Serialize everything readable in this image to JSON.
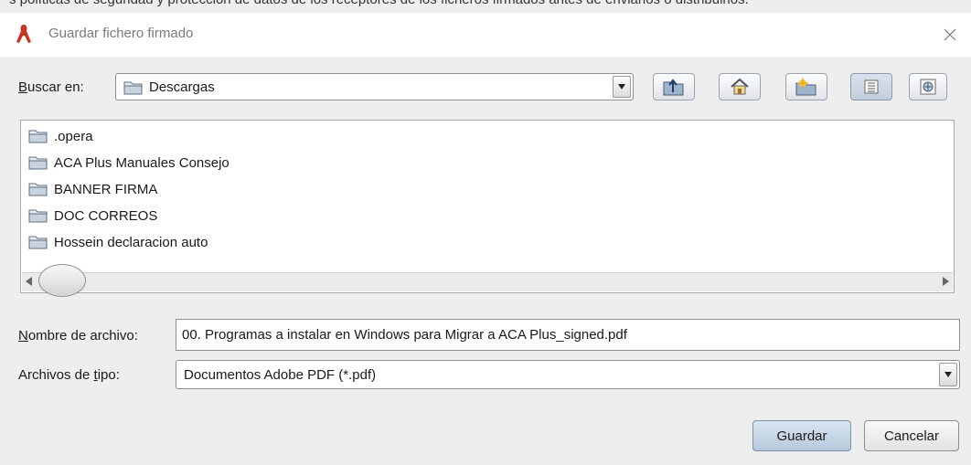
{
  "background": {
    "clipped_text": "s políticas de seguridad y protección de datos de los receptores de los ficheros firmados antes de enviarlos o distribuirlos."
  },
  "window": {
    "title": "Guardar fichero firmado"
  },
  "lookin": {
    "label_prefix": "",
    "label_mnemonic": "B",
    "label_rest": "uscar en:",
    "value": "Descargas"
  },
  "toolbar": {
    "buttons": [
      "up-one-level",
      "home",
      "new-folder",
      "list-view",
      "details-view"
    ]
  },
  "files": [
    {
      "name": ".opera"
    },
    {
      "name": "ACA Plus Manuales Consejo"
    },
    {
      "name": "BANNER FIRMA"
    },
    {
      "name": "DOC CORREOS"
    },
    {
      "name": "Hossein declaracion auto"
    }
  ],
  "filename": {
    "label_mnemonic": "N",
    "label_rest": "ombre de archivo:",
    "value": "00. Programas a instalar en Windows para Migrar a ACA Plus_signed.pdf"
  },
  "filetype": {
    "label_prefix": "Archivos de ",
    "label_mnemonic": "t",
    "label_rest": "ipo:",
    "value": "Documentos Adobe PDF (*.pdf)"
  },
  "buttons": {
    "save": "Guardar",
    "cancel": "Cancelar"
  },
  "colors": {
    "accent": "#c8341f",
    "folder": "#7a8da3"
  }
}
